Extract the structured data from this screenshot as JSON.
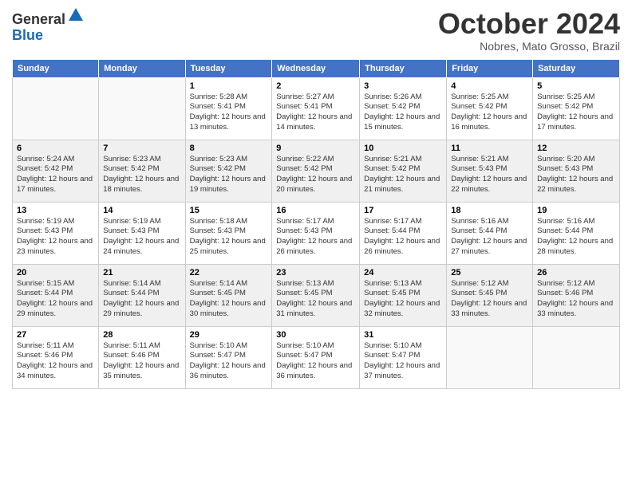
{
  "header": {
    "logo_general": "General",
    "logo_blue": "Blue",
    "month": "October 2024",
    "location": "Nobres, Mato Grosso, Brazil"
  },
  "days_of_week": [
    "Sunday",
    "Monday",
    "Tuesday",
    "Wednesday",
    "Thursday",
    "Friday",
    "Saturday"
  ],
  "weeks": [
    [
      {
        "day": "",
        "sunrise": "",
        "sunset": "",
        "daylight": ""
      },
      {
        "day": "",
        "sunrise": "",
        "sunset": "",
        "daylight": ""
      },
      {
        "day": "1",
        "sunrise": "Sunrise: 5:28 AM",
        "sunset": "Sunset: 5:41 PM",
        "daylight": "Daylight: 12 hours and 13 minutes."
      },
      {
        "day": "2",
        "sunrise": "Sunrise: 5:27 AM",
        "sunset": "Sunset: 5:41 PM",
        "daylight": "Daylight: 12 hours and 14 minutes."
      },
      {
        "day": "3",
        "sunrise": "Sunrise: 5:26 AM",
        "sunset": "Sunset: 5:42 PM",
        "daylight": "Daylight: 12 hours and 15 minutes."
      },
      {
        "day": "4",
        "sunrise": "Sunrise: 5:25 AM",
        "sunset": "Sunset: 5:42 PM",
        "daylight": "Daylight: 12 hours and 16 minutes."
      },
      {
        "day": "5",
        "sunrise": "Sunrise: 5:25 AM",
        "sunset": "Sunset: 5:42 PM",
        "daylight": "Daylight: 12 hours and 17 minutes."
      }
    ],
    [
      {
        "day": "6",
        "sunrise": "Sunrise: 5:24 AM",
        "sunset": "Sunset: 5:42 PM",
        "daylight": "Daylight: 12 hours and 17 minutes."
      },
      {
        "day": "7",
        "sunrise": "Sunrise: 5:23 AM",
        "sunset": "Sunset: 5:42 PM",
        "daylight": "Daylight: 12 hours and 18 minutes."
      },
      {
        "day": "8",
        "sunrise": "Sunrise: 5:23 AM",
        "sunset": "Sunset: 5:42 PM",
        "daylight": "Daylight: 12 hours and 19 minutes."
      },
      {
        "day": "9",
        "sunrise": "Sunrise: 5:22 AM",
        "sunset": "Sunset: 5:42 PM",
        "daylight": "Daylight: 12 hours and 20 minutes."
      },
      {
        "day": "10",
        "sunrise": "Sunrise: 5:21 AM",
        "sunset": "Sunset: 5:42 PM",
        "daylight": "Daylight: 12 hours and 21 minutes."
      },
      {
        "day": "11",
        "sunrise": "Sunrise: 5:21 AM",
        "sunset": "Sunset: 5:43 PM",
        "daylight": "Daylight: 12 hours and 22 minutes."
      },
      {
        "day": "12",
        "sunrise": "Sunrise: 5:20 AM",
        "sunset": "Sunset: 5:43 PM",
        "daylight": "Daylight: 12 hours and 22 minutes."
      }
    ],
    [
      {
        "day": "13",
        "sunrise": "Sunrise: 5:19 AM",
        "sunset": "Sunset: 5:43 PM",
        "daylight": "Daylight: 12 hours and 23 minutes."
      },
      {
        "day": "14",
        "sunrise": "Sunrise: 5:19 AM",
        "sunset": "Sunset: 5:43 PM",
        "daylight": "Daylight: 12 hours and 24 minutes."
      },
      {
        "day": "15",
        "sunrise": "Sunrise: 5:18 AM",
        "sunset": "Sunset: 5:43 PM",
        "daylight": "Daylight: 12 hours and 25 minutes."
      },
      {
        "day": "16",
        "sunrise": "Sunrise: 5:17 AM",
        "sunset": "Sunset: 5:43 PM",
        "daylight": "Daylight: 12 hours and 26 minutes."
      },
      {
        "day": "17",
        "sunrise": "Sunrise: 5:17 AM",
        "sunset": "Sunset: 5:44 PM",
        "daylight": "Daylight: 12 hours and 26 minutes."
      },
      {
        "day": "18",
        "sunrise": "Sunrise: 5:16 AM",
        "sunset": "Sunset: 5:44 PM",
        "daylight": "Daylight: 12 hours and 27 minutes."
      },
      {
        "day": "19",
        "sunrise": "Sunrise: 5:16 AM",
        "sunset": "Sunset: 5:44 PM",
        "daylight": "Daylight: 12 hours and 28 minutes."
      }
    ],
    [
      {
        "day": "20",
        "sunrise": "Sunrise: 5:15 AM",
        "sunset": "Sunset: 5:44 PM",
        "daylight": "Daylight: 12 hours and 29 minutes."
      },
      {
        "day": "21",
        "sunrise": "Sunrise: 5:14 AM",
        "sunset": "Sunset: 5:44 PM",
        "daylight": "Daylight: 12 hours and 29 minutes."
      },
      {
        "day": "22",
        "sunrise": "Sunrise: 5:14 AM",
        "sunset": "Sunset: 5:45 PM",
        "daylight": "Daylight: 12 hours and 30 minutes."
      },
      {
        "day": "23",
        "sunrise": "Sunrise: 5:13 AM",
        "sunset": "Sunset: 5:45 PM",
        "daylight": "Daylight: 12 hours and 31 minutes."
      },
      {
        "day": "24",
        "sunrise": "Sunrise: 5:13 AM",
        "sunset": "Sunset: 5:45 PM",
        "daylight": "Daylight: 12 hours and 32 minutes."
      },
      {
        "day": "25",
        "sunrise": "Sunrise: 5:12 AM",
        "sunset": "Sunset: 5:45 PM",
        "daylight": "Daylight: 12 hours and 33 minutes."
      },
      {
        "day": "26",
        "sunrise": "Sunrise: 5:12 AM",
        "sunset": "Sunset: 5:46 PM",
        "daylight": "Daylight: 12 hours and 33 minutes."
      }
    ],
    [
      {
        "day": "27",
        "sunrise": "Sunrise: 5:11 AM",
        "sunset": "Sunset: 5:46 PM",
        "daylight": "Daylight: 12 hours and 34 minutes."
      },
      {
        "day": "28",
        "sunrise": "Sunrise: 5:11 AM",
        "sunset": "Sunset: 5:46 PM",
        "daylight": "Daylight: 12 hours and 35 minutes."
      },
      {
        "day": "29",
        "sunrise": "Sunrise: 5:10 AM",
        "sunset": "Sunset: 5:47 PM",
        "daylight": "Daylight: 12 hours and 36 minutes."
      },
      {
        "day": "30",
        "sunrise": "Sunrise: 5:10 AM",
        "sunset": "Sunset: 5:47 PM",
        "daylight": "Daylight: 12 hours and 36 minutes."
      },
      {
        "day": "31",
        "sunrise": "Sunrise: 5:10 AM",
        "sunset": "Sunset: 5:47 PM",
        "daylight": "Daylight: 12 hours and 37 minutes."
      },
      {
        "day": "",
        "sunrise": "",
        "sunset": "",
        "daylight": ""
      },
      {
        "day": "",
        "sunrise": "",
        "sunset": "",
        "daylight": ""
      }
    ]
  ]
}
